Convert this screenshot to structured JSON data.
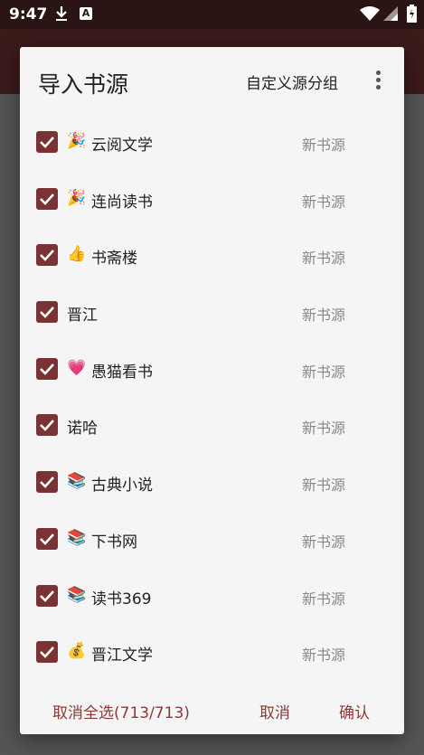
{
  "status_bar": {
    "time": "9:47",
    "notification_letter": "A"
  },
  "dialog": {
    "title": "导入书源",
    "group_button": "自定义源分组",
    "items": [
      {
        "emoji": "🎉",
        "name": "云阅文学",
        "tag": "新书源",
        "checked": true
      },
      {
        "emoji": "🎉",
        "name": "连尚读书",
        "tag": "新书源",
        "checked": true
      },
      {
        "emoji": "👍",
        "name": "书斋楼",
        "tag": "新书源",
        "checked": true
      },
      {
        "emoji": "",
        "name": "晋江",
        "tag": "新书源",
        "checked": true
      },
      {
        "emoji": "💗",
        "name": "愚猫看书",
        "tag": "新书源",
        "checked": true
      },
      {
        "emoji": "",
        "name": "诺哈",
        "tag": "新书源",
        "checked": true
      },
      {
        "emoji": "📚",
        "name": "古典小说",
        "tag": "新书源",
        "checked": true
      },
      {
        "emoji": "📚",
        "name": "下书网",
        "tag": "新书源",
        "checked": true
      },
      {
        "emoji": "📚",
        "name": "读书369",
        "tag": "新书源",
        "checked": true
      },
      {
        "emoji": "💰",
        "name": "晋江文学",
        "tag": "新书源",
        "checked": true
      }
    ],
    "footer": {
      "deselect_all": "取消全选(713/713)",
      "cancel": "取消",
      "confirm": "确认"
    }
  },
  "colors": {
    "accent": "#7b3234",
    "button_text": "#8a3a36"
  }
}
